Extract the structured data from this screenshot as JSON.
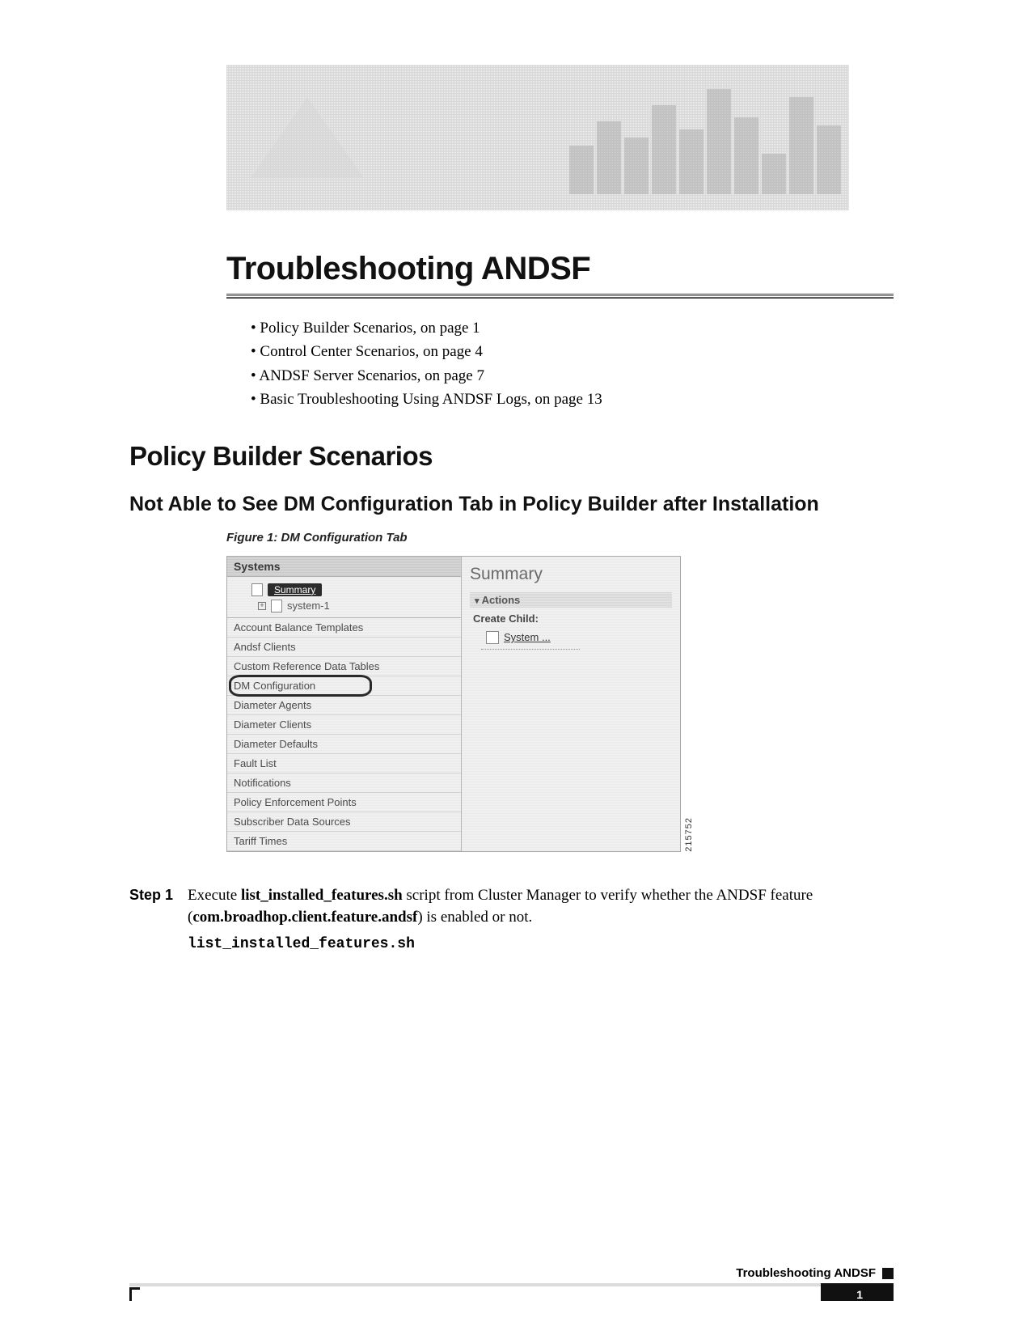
{
  "chapterTitle": "Troubleshooting ANDSF",
  "toc": [
    "Policy Builder Scenarios, on page 1",
    "Control Center Scenarios, on page 4",
    "ANDSF Server Scenarios, on page 7",
    "Basic Troubleshooting Using ANDSF Logs, on page 13"
  ],
  "h1": "Policy Builder Scenarios",
  "h2": "Not Able to See DM Configuration Tab in Policy Builder after Installation",
  "figure": {
    "caption": "Figure 1: DM Configuration Tab",
    "id": "215752",
    "left": {
      "section": "Systems",
      "tree": {
        "selected": "Summary",
        "child": "system-1"
      },
      "items": [
        "Account Balance Templates",
        "Andsf Clients",
        "Custom Reference Data Tables",
        "DM Configuration",
        "Diameter Agents",
        "Diameter Clients",
        "Diameter Defaults",
        "Fault List",
        "Notifications",
        "Policy Enforcement Points",
        "Subscriber Data Sources",
        "Tariff Times"
      ],
      "highlightIndex": 3
    },
    "right": {
      "title": "Summary",
      "actions": "Actions",
      "createChild": "Create Child:",
      "link": "System ..."
    }
  },
  "step": {
    "label": "Step 1",
    "text1": "Execute ",
    "bold1": "list_installed_features.sh",
    "text2": " script from Cluster Manager to verify whether the ANDSF feature (",
    "bold2": "com.broadhop.client.feature.andsf",
    "text3": ") is enabled or not.",
    "command": "list_installed_features.sh"
  },
  "footer": {
    "title": "Troubleshooting ANDSF",
    "page": "1"
  }
}
